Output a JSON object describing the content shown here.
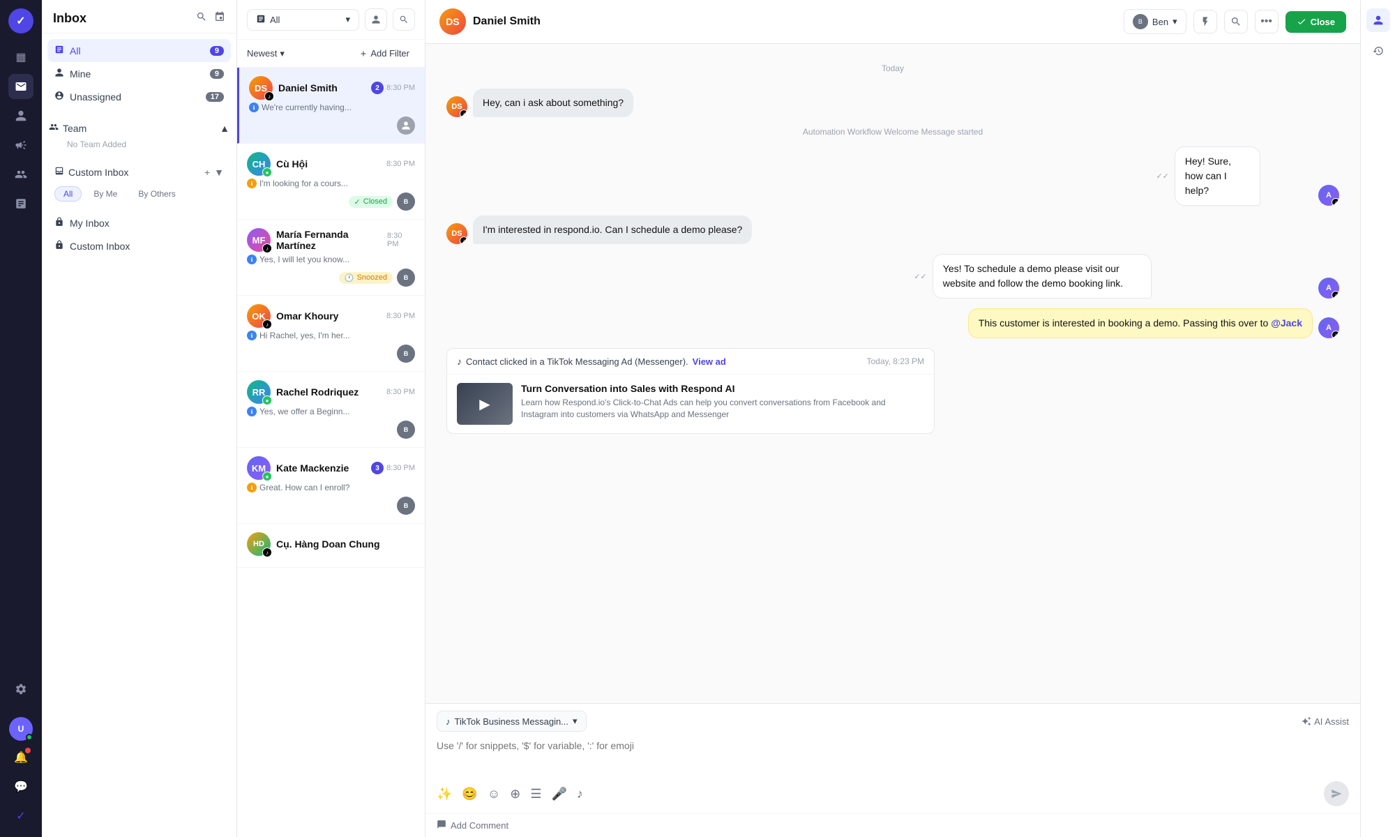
{
  "app": {
    "title": "Inbox"
  },
  "icon_bar": {
    "logo": "✓",
    "nav": [
      {
        "name": "grid-icon",
        "symbol": "▦",
        "active": false
      },
      {
        "name": "inbox-icon",
        "symbol": "✉",
        "active": true
      },
      {
        "name": "contacts-icon",
        "symbol": "👤",
        "active": false
      },
      {
        "name": "campaigns-icon",
        "symbol": "📢",
        "active": false
      },
      {
        "name": "team-icon",
        "symbol": "👥",
        "active": false
      },
      {
        "name": "reports-icon",
        "symbol": "📊",
        "active": false
      },
      {
        "name": "settings-icon",
        "symbol": "⚙",
        "active": false
      }
    ],
    "bottom": [
      {
        "name": "notification-icon",
        "symbol": "🔔"
      },
      {
        "name": "chat-icon",
        "symbol": "💬"
      },
      {
        "name": "check-icon",
        "symbol": "✓"
      }
    ],
    "avatar_initials": "U"
  },
  "sidebar": {
    "title": "Inbox",
    "nav_items": [
      {
        "label": "All",
        "count": 9,
        "active": true
      },
      {
        "label": "Mine",
        "count": 9,
        "active": false
      },
      {
        "label": "Unassigned",
        "count": 17,
        "active": false
      }
    ],
    "team_section": {
      "label": "Team",
      "no_team_text": "No Team Added"
    },
    "custom_inbox": {
      "label": "Custom Inbox",
      "tabs": [
        "All",
        "By Me",
        "By Others"
      ],
      "active_tab": "All"
    },
    "inbox_items": [
      {
        "label": "My Inbox"
      },
      {
        "label": "Custom Inbox"
      }
    ]
  },
  "conv_list": {
    "filter_label": "All",
    "sort_label": "Newest",
    "add_filter_label": "Add Filter",
    "conversations": [
      {
        "name": "Daniel Smith",
        "preview": "We're currently having...",
        "time": "8:30 PM",
        "unread": 2,
        "status": null,
        "active": true,
        "platform_color": "#3b82f6",
        "av_class": "av-daniel"
      },
      {
        "name": "Cù Hội",
        "preview": "I'm looking for a cours...",
        "time": "8:30 PM",
        "unread": 0,
        "status": "Closed",
        "status_type": "closed",
        "active": false,
        "platform_color": "#f59e0b",
        "av_class": "av-cu"
      },
      {
        "name": "María Fernanda Martínez",
        "preview": "Yes, I will let you know...",
        "time": "8:30 PM",
        "unread": 0,
        "status": "Snoozed",
        "status_type": "snoozed",
        "active": false,
        "platform_color": "#3b82f6",
        "av_class": "av-maria"
      },
      {
        "name": "Omar Khoury",
        "preview": "Hi Rachel, yes, I'm her...",
        "time": "8:30 PM",
        "unread": 0,
        "status": null,
        "active": false,
        "platform_color": "#3b82f6",
        "av_class": "av-omar"
      },
      {
        "name": "Rachel Rodriquez",
        "preview": "Yes, we offer a Beginn...",
        "time": "8:30 PM",
        "unread": 0,
        "status": null,
        "active": false,
        "platform_color": "#3b82f6",
        "av_class": "av-rachel"
      },
      {
        "name": "Kate Mackenzie",
        "preview": "Great. How can I enroll?",
        "time": "8:30 PM",
        "unread": 3,
        "status": null,
        "active": false,
        "platform_color": "#f59e0b",
        "av_class": "av-kate"
      },
      {
        "name": "Cụ. Hàng Doan Chung",
        "preview": "",
        "time": "",
        "unread": 0,
        "status": null,
        "active": false,
        "platform_color": "#3b82f6",
        "av_class": "av-hang"
      }
    ]
  },
  "chat": {
    "contact_name": "Daniel Smith",
    "agent_name": "Ben",
    "date_label": "Today",
    "close_btn": "Close",
    "messages": [
      {
        "type": "incoming",
        "text": "Hey, can i ask about something?",
        "avatar": "D"
      },
      {
        "type": "system",
        "text": "Automation Workflow Welcome Message started"
      },
      {
        "type": "outgoing",
        "text": "Hey! Sure, how can I help?",
        "avatar": "A"
      },
      {
        "type": "incoming",
        "text": "I'm interested in respond.io. Can I schedule a demo please?",
        "avatar": "D"
      },
      {
        "type": "outgoing",
        "text": "Yes! To schedule a demo please visit our website and follow the demo booking link.",
        "avatar": "A"
      },
      {
        "type": "outgoing_highlight",
        "text": "This customer is interested in booking a demo. Passing this over to @Jack",
        "avatar": "A",
        "mention": "@Jack"
      }
    ],
    "ad_card": {
      "icon": "♪",
      "description": "Contact clicked in a TikTok Messaging Ad (Messenger).",
      "view_ad_label": "View ad",
      "timestamp": "Today, 8:23 PM",
      "title": "Turn Conversation into Sales with Respond AI",
      "body": "Learn how Respond.io's Click-to-Chat Ads can help you convert conversations from Facebook and Instagram into customers via WhatsApp and Messenger"
    },
    "compose": {
      "channel_label": "TikTok Business Messagin...",
      "placeholder": "Use '/' for snippets, '$' for variable, ':' for emoji",
      "ai_assist_label": "AI Assist",
      "add_comment_label": "Add Comment"
    }
  }
}
